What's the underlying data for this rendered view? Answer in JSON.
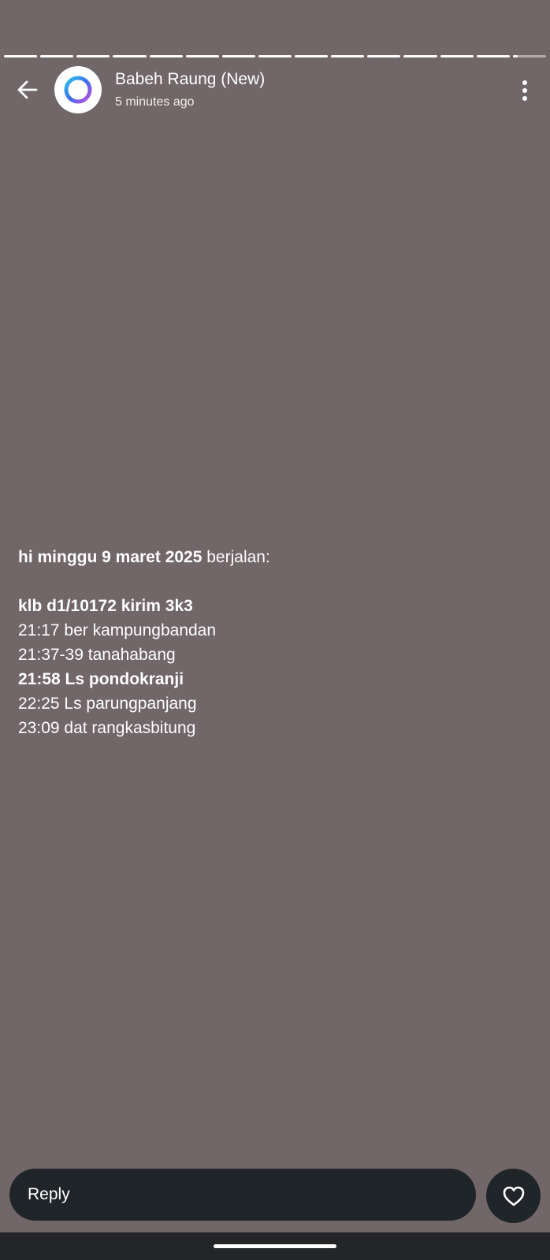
{
  "header": {
    "channel_name": "Babeh Raung (New)",
    "timestamp": "5 minutes ago"
  },
  "progress": {
    "total_segments": 15,
    "completed_segments": 14,
    "current_segment_progress": 0.15
  },
  "message": {
    "lines": [
      [
        {
          "text": "hi minggu 9 maret 2025",
          "bold": true
        },
        {
          "text": " berjalan:",
          "bold": false
        }
      ],
      [],
      [
        {
          "text": "klb d1/10172 kirim 3k3",
          "bold": true
        }
      ],
      [
        {
          "text": "21:17 ber kampungbandan",
          "bold": false
        }
      ],
      [
        {
          "text": "21:37-39 tanahabang",
          "bold": false
        }
      ],
      [
        {
          "text": "21:58 Ls pondokranji",
          "bold": true
        }
      ],
      [
        {
          "text": "22:25 Ls parungpanjang",
          "bold": false
        }
      ],
      [
        {
          "text": "23:09 dat rangkasbitung",
          "bold": false
        }
      ]
    ]
  },
  "reply": {
    "placeholder": "Reply"
  },
  "icons": {
    "back": "back-arrow-icon",
    "avatar": "channel-ring-logo",
    "menu": "more-vertical-icon",
    "like": "heart-icon"
  },
  "colors": {
    "background": "#716668",
    "bar": "#1f2528",
    "text": "#ffffff"
  }
}
